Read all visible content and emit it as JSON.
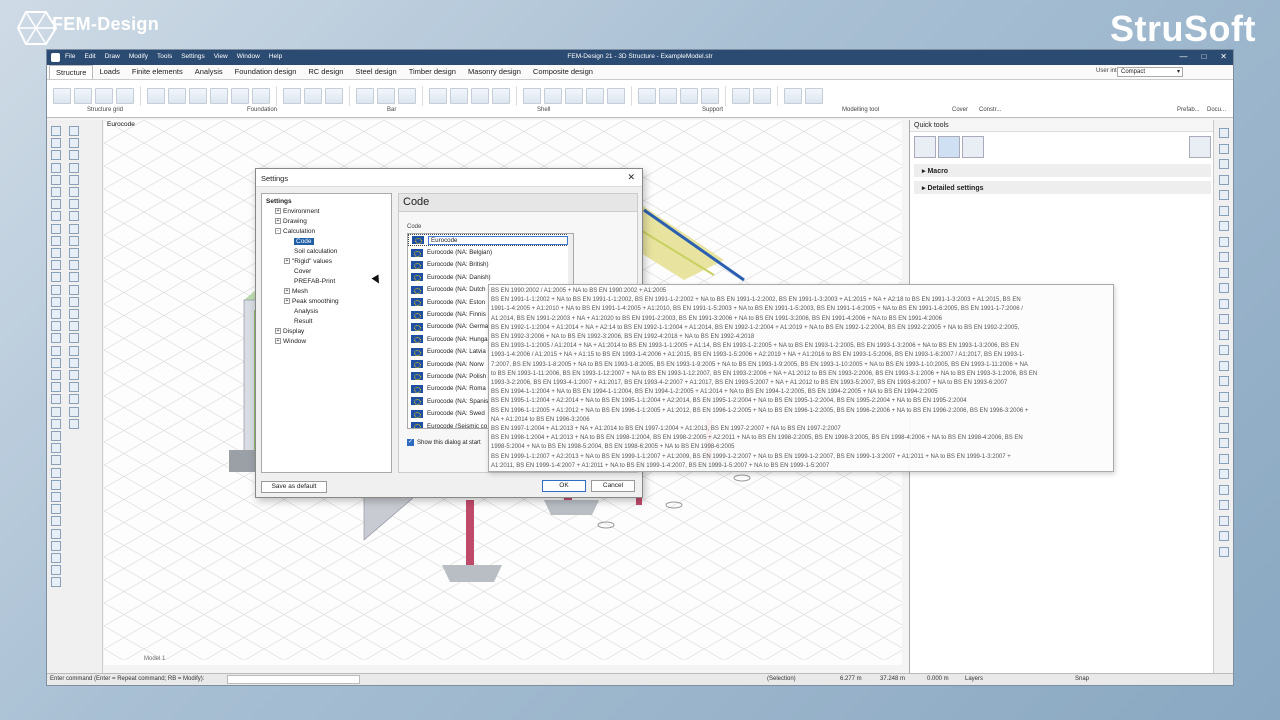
{
  "branding": {
    "left_logo_text": "FEM-Design",
    "right_logo_text": "StruSoft"
  },
  "titlebar": {
    "title": "FEM-Design 21 - 3D Structure - ExampleModel.str",
    "menu": [
      "File",
      "Edit",
      "Draw",
      "Modify",
      "Tools",
      "Settings",
      "View",
      "Window",
      "Help"
    ]
  },
  "ribbon": {
    "tabs": [
      "Structure",
      "Loads",
      "Finite elements",
      "Analysis",
      "Foundation design",
      "RC design",
      "Steel design",
      "Timber design",
      "Masonry design",
      "Composite design"
    ],
    "active_tab": "Structure",
    "user_interface_label": "User interface:",
    "user_interface_value": "Compact",
    "groups": [
      "Structure grid",
      "Foundation",
      "Bar",
      "Shell",
      "Support",
      "Modelling tool",
      "Cover",
      "Constr...",
      "Prefab...",
      "Docu..."
    ]
  },
  "viewport": {
    "label": "Eurocode",
    "tabs": "Model 1"
  },
  "quick_tools": {
    "title": "Quick tools",
    "sections": [
      "Macro",
      "Detailed settings"
    ]
  },
  "statusbar": {
    "command_prompt": "Enter command (Enter = Repeat command; RB = Modify):",
    "selection": "(Selection)",
    "x": "6.277 m",
    "y": "37.248 m",
    "z": "0.000 m",
    "layers": "Layers",
    "snap": "Snap"
  },
  "dialog": {
    "title": "Settings",
    "content_title": "Code",
    "code_label": "Code",
    "tree": [
      {
        "label": "Settings",
        "level": 0,
        "bold": true,
        "expander": ""
      },
      {
        "label": "Environment",
        "level": 1,
        "expander": "+"
      },
      {
        "label": "Drawing",
        "level": 1,
        "expander": "+"
      },
      {
        "label": "Calculation",
        "level": 1,
        "expander": "-"
      },
      {
        "label": "Code",
        "level": 2,
        "selected": true,
        "expander": ""
      },
      {
        "label": "Soil calculation",
        "level": 2,
        "expander": ""
      },
      {
        "label": "\"Rigid\" values",
        "level": 2,
        "expander": "+"
      },
      {
        "label": "Cover",
        "level": 2,
        "expander": ""
      },
      {
        "label": "PREFAB-Print",
        "level": 2,
        "expander": ""
      },
      {
        "label": "Mesh",
        "level": 2,
        "expander": "+"
      },
      {
        "label": "Peak smoothing",
        "level": 2,
        "expander": "+"
      },
      {
        "label": "Analysis",
        "level": 2,
        "expander": ""
      },
      {
        "label": "Result",
        "level": 2,
        "expander": ""
      },
      {
        "label": "Display",
        "level": 1,
        "expander": "+"
      },
      {
        "label": "Window",
        "level": 1,
        "expander": "+"
      }
    ],
    "codes": [
      "Eurocode",
      "Eurocode (NA: Belgian)",
      "Eurocode (NA: British)",
      "Eurocode (NA: Danish)",
      "Eurocode (NA: Dutch",
      "Eurocode (NA: Eston",
      "Eurocode (NA: Finnis",
      "Eurocode (NA: Germa",
      "Eurocode (NA: Hunga",
      "Eurocode (NA: Latvia",
      "Eurocode (NA: Norw",
      "Eurocode (NA: Polish",
      "Eurocode (NA: Roma",
      "Eurocode (NA: Spanis",
      "Eurocode (NA: Swed",
      "Eurocode (Seismic co"
    ],
    "selected_code": "Eurocode",
    "show_dialog_label": "Show this dialog at start",
    "save_default": "Save as default",
    "ok": "OK",
    "cancel": "Cancel"
  },
  "tooltip": {
    "lines": [
      "BS EN 1990:2002 / A1:2005 + NA to BS EN 1990:2002 + A1:2005",
      "BS EN 1991-1-1:2002 + NA to BS EN 1991-1-1:2002, BS EN 1991-1-2:2002 + NA to BS EN 1991-1-2:2002, BS EN 1991-1-3:2003 + A1:2015 + NA + A2:18 to BS EN 1991-1-3:2003 + A1:2015, BS EN",
      "1991-1-4:2005 + A1:2010 + NA to BS EN 1991-1-4:2005 + A1:2010, BS EN 1991-1-5:2003 + NA to BS EN 1991-1-5:2003, BS EN 1991-1-6:2005 + NA to BS EN 1991-1-6:2005, BS EN 1991-1-7:2006 /",
      "A1:2014, BS EN 1991-2:2003 + NA + A1:2020 to BS EN 1991-2:2003, BS EN 1991-3:2006 + NA to BS EN 1991-3:2006, BS EN 1991-4:2006 + NA to BS EN 1991-4:2006",
      "BS EN 1992-1-1:2004 + A1:2014 + NA + A2:14 to BS EN 1992-1-1:2004 + A1:2014, BS EN 1992-1-2:2004 + A1:2019 + NA to BS EN 1992-1-2:2004, BS EN 1992-2:2005 + NA to BS EN 1992-2:2005,",
      "BS EN 1992-3:2006 + NA to BS EN 1992-3:2006, BS EN 1992-4:2018 + NA to BS EN 1992-4:2018",
      "BS EN 1993-1-1:2005 / A1:2014 + NA + A1:2014 to BS EN 1993-1-1:2005 + A1:14, BS EN 1993-1-2:2005 + NA to BS EN 1993-1-2:2005, BS EN 1993-1-3:2006 + NA to BS EN 1993-1-3:2006, BS EN",
      "1993-1-4:2006 / A1:2015 + NA + A1:15 to BS EN 1993-1-4:2006 + A1:2015, BS EN 1993-1-5:2006 + A2:2019 + NA + A1:2016 to BS EN 1993-1-5:2006, BS EN 1993-1-6:2007 / A1:2017, BS EN 1993-1-",
      "7:2007, BS EN 1993-1-8:2005 + NA to BS EN 1993-1-8:2005, BS EN 1993-1-9:2005 + NA to BS EN 1993-1-9:2005, BS EN 1993-1-10:2005 + NA to BS EN 1993-1-10:2005, BS EN 1993-1-11:2006 + NA",
      "to BS EN 1993-1-11:2006, BS EN 1993-1-12:2007 + NA to BS EN 1993-1-12:2007, BS EN 1993-2:2006 + NA + A1:2012 to BS EN 1993-2:2006, BS EN 1993-3-1:2006 + NA to BS EN 1993-3-1:2006, BS EN",
      "1993-3-2:2006, BS EN 1993-4-1:2007 + A1:2017, BS EN 1993-4-2:2007 + A1:2017, BS EN 1993-5:2007 + NA + A1:2012 to BS EN 1993-5:2007, BS EN 1993-6:2007 + NA to BS EN 1993-6:2007",
      "BS EN 1994-1-1:2004 + NA to BS EN 1994-1-1:2004, BS EN 1994-1-2:2005 + A1:2014 + NA to BS EN 1994-1-2:2005, BS EN 1994-2:2005 + NA to BS EN 1994-2:2005",
      "BS EN 1995-1-1:2004 + A2:2014 + NA to BS EN 1995-1-1:2004 + A2:2014, BS EN 1995-1-2:2004 + NA to BS EN 1995-1-2:2004, BS EN 1995-2:2004 + NA to BS EN 1995-2:2004",
      "BS EN 1996-1-1:2005 + A1:2012 + NA to BS EN 1996-1-1:2005 + A1:2012, BS EN 1996-1-2:2005 + NA to BS EN 1996-1-2:2005, BS EN 1996-2:2006 + NA to BS EN 1996-2:2006, BS EN 1996-3:2006 +",
      "NA + A1:2014 to BS EN 1996-3:2006",
      "BS EN 1997-1:2004 + A1:2013 + NA + A1:2014 to BS EN 1997-1:2004 + A1:2013, BS EN 1997-2:2007 + NA to BS EN 1997-2:2007",
      "BS EN 1998-1:2004 + A1:2013 + NA to BS EN 1998-1:2004, BS EN 1998-2:2005 + A2:2011 + NA to BS EN 1998-2:2005, BS EN 1998-3:2005, BS EN 1998-4:2006 + NA to BS EN 1998-4:2006, BS EN",
      "1998-5:2004 + NA to BS EN 1998-5:2004, BS EN 1998-6:2005 + NA to BS EN 1998-6:2005",
      "BS EN 1999-1-1:2007 + A2:2013 + NA to BS EN 1999-1-1:2007 + A1:2009, BS EN 1999-1-2:2007 + NA to BS EN 1999-1-2:2007, BS EN 1999-1-3:2007 + A1:2011 + NA to BS EN 1999-1-3:2007 +",
      "A1:2011, BS EN 1999-1-4:2007 + A1:2011 + NA to BS EN 1999-1-4:2007, BS EN 1999-1-5:2007 + NA to BS EN 1999-1-5:2007"
    ]
  },
  "colors": {
    "titlebar": "#2b4b72",
    "selection": "#1f5fa8",
    "flag": "#1e4fa3"
  }
}
